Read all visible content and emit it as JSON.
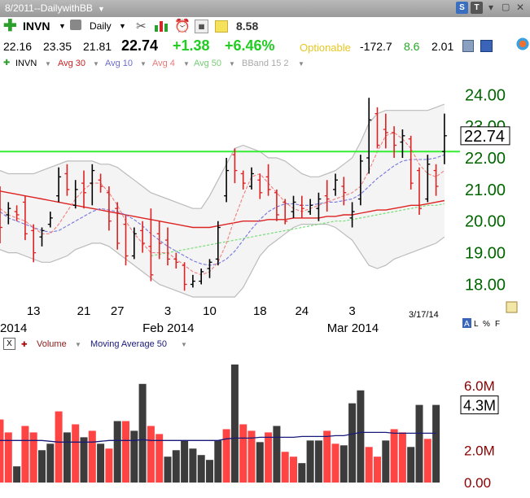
{
  "window": {
    "title": "8/2011--DailywithBB"
  },
  "toolbar": {
    "symbol": "INVN",
    "interval": "Daily",
    "price_box": "8.58"
  },
  "quote": {
    "open": "22.16",
    "high": "23.35",
    "low": "21.81",
    "last": "22.74",
    "change": "+1.38",
    "change_pct": "+6.46%",
    "optionable": "Optionable",
    "v1": "-172.7",
    "v2": "8.6",
    "v3": "2.01"
  },
  "legend": {
    "symbol": "INVN",
    "avg30": "Avg 30",
    "avg10": "Avg 10",
    "avg4": "Avg 4",
    "avg50": "Avg 50",
    "bband": "BBand 15 2",
    "volume": "Volume",
    "ma50": "Moving Average 50",
    "close_label": "X"
  },
  "colors": {
    "up": "#000000",
    "down": "#dd2222",
    "avg30": "#dd2222",
    "avg10": "#7777dd",
    "avg4": "#f08080",
    "avg50": "#77dd77",
    "hline": "#33ee33",
    "vol_up": "#3c3c3c",
    "vol_down": "#ff4444",
    "vol_ma": "#1a1a7a",
    "price_axis": "#006600",
    "vol_axis": "#8b0000",
    "band_fill": "#f4f4f4",
    "band_line": "#bbbbbb"
  },
  "chart_data": [
    {
      "type": "ohlc",
      "ylim": [
        17.6,
        24.6
      ],
      "yticks": [
        18,
        19,
        20,
        21,
        22,
        23,
        24
      ],
      "ytick_labels": [
        "18.00",
        "19.00",
        "20.00",
        "21.00",
        "22.00",
        "23.00",
        "24.00"
      ],
      "last_value_label": "22.74",
      "horizontal_line": 22.2,
      "date_labels": [
        "13",
        "21",
        "27",
        "3",
        "10",
        "18",
        "24",
        "3"
      ],
      "date_label_bars": [
        4,
        10,
        14,
        20,
        25,
        31,
        36,
        42
      ],
      "month_labels": [
        "2014",
        "Feb 2014",
        "Mar 2014"
      ],
      "month_label_bars": [
        0,
        17,
        39
      ],
      "footer_date": "3/17/14",
      "bars": [
        {
          "o": 20.8,
          "h": 21.1,
          "l": 19.3,
          "c": 19.8
        },
        {
          "o": 20.2,
          "h": 20.6,
          "l": 19.9,
          "c": 20.4
        },
        {
          "o": 20.3,
          "h": 20.5,
          "l": 20.0,
          "c": 20.2
        },
        {
          "o": 20.6,
          "h": 20.8,
          "l": 19.4,
          "c": 19.6
        },
        {
          "o": 19.7,
          "h": 19.9,
          "l": 18.7,
          "c": 19.0
        },
        {
          "o": 19.5,
          "h": 19.8,
          "l": 19.2,
          "c": 19.7
        },
        {
          "o": 19.9,
          "h": 20.3,
          "l": 19.8,
          "c": 20.1
        },
        {
          "o": 20.8,
          "h": 21.7,
          "l": 20.6,
          "c": 21.4
        },
        {
          "o": 21.5,
          "h": 21.8,
          "l": 20.8,
          "c": 21.0
        },
        {
          "o": 20.5,
          "h": 21.3,
          "l": 20.4,
          "c": 21.0
        },
        {
          "o": 21.2,
          "h": 21.6,
          "l": 20.4,
          "c": 20.9
        },
        {
          "o": 21.2,
          "h": 21.8,
          "l": 20.5,
          "c": 21.6
        },
        {
          "o": 21.3,
          "h": 21.5,
          "l": 20.9,
          "c": 21.1
        },
        {
          "o": 20.9,
          "h": 21.1,
          "l": 19.7,
          "c": 20.0
        },
        {
          "o": 20.4,
          "h": 20.6,
          "l": 19.1,
          "c": 19.3
        },
        {
          "o": 19.9,
          "h": 20.2,
          "l": 18.6,
          "c": 18.9
        },
        {
          "o": 18.9,
          "h": 19.8,
          "l": 18.8,
          "c": 19.6
        },
        {
          "o": 19.7,
          "h": 20.0,
          "l": 19.0,
          "c": 19.3
        },
        {
          "o": 19.2,
          "h": 20.4,
          "l": 18.1,
          "c": 18.3
        },
        {
          "o": 19.6,
          "h": 20.0,
          "l": 18.8,
          "c": 19.3
        },
        {
          "o": 19.4,
          "h": 19.8,
          "l": 18.6,
          "c": 18.8
        },
        {
          "o": 18.8,
          "h": 19.0,
          "l": 18.5,
          "c": 18.7
        },
        {
          "o": 18.6,
          "h": 18.7,
          "l": 17.8,
          "c": 18.0
        },
        {
          "o": 18.0,
          "h": 18.3,
          "l": 17.9,
          "c": 18.1
        },
        {
          "o": 18.1,
          "h": 18.5,
          "l": 18.0,
          "c": 18.4
        },
        {
          "o": 18.5,
          "h": 18.8,
          "l": 18.2,
          "c": 18.7
        },
        {
          "o": 18.8,
          "h": 20.0,
          "l": 18.6,
          "c": 19.8
        },
        {
          "o": 20.8,
          "h": 22.0,
          "l": 20.6,
          "c": 21.6
        },
        {
          "o": 22.1,
          "h": 22.3,
          "l": 21.2,
          "c": 21.6
        },
        {
          "o": 21.5,
          "h": 21.6,
          "l": 21.0,
          "c": 21.2
        },
        {
          "o": 21.1,
          "h": 21.7,
          "l": 21.0,
          "c": 21.5
        },
        {
          "o": 21.3,
          "h": 21.5,
          "l": 20.7,
          "c": 20.9
        },
        {
          "o": 21.4,
          "h": 21.8,
          "l": 20.8,
          "c": 21.0
        },
        {
          "o": 20.9,
          "h": 21.0,
          "l": 20.0,
          "c": 20.2
        },
        {
          "o": 20.6,
          "h": 20.7,
          "l": 19.9,
          "c": 20.0
        },
        {
          "o": 20.3,
          "h": 20.8,
          "l": 20.1,
          "c": 20.6
        },
        {
          "o": 20.5,
          "h": 20.8,
          "l": 20.1,
          "c": 20.4
        },
        {
          "o": 20.3,
          "h": 20.7,
          "l": 20.2,
          "c": 20.5
        },
        {
          "o": 20.4,
          "h": 20.9,
          "l": 20.0,
          "c": 20.7
        },
        {
          "o": 20.8,
          "h": 21.3,
          "l": 20.3,
          "c": 20.7
        },
        {
          "o": 21.0,
          "h": 21.5,
          "l": 20.8,
          "c": 21.3
        },
        {
          "o": 21.1,
          "h": 21.4,
          "l": 20.5,
          "c": 20.9
        },
        {
          "o": 20.1,
          "h": 20.6,
          "l": 19.8,
          "c": 20.3
        },
        {
          "o": 20.7,
          "h": 22.1,
          "l": 20.5,
          "c": 21.9
        },
        {
          "o": 22.0,
          "h": 23.9,
          "l": 21.5,
          "c": 23.2
        },
        {
          "o": 23.4,
          "h": 23.6,
          "l": 22.3,
          "c": 22.4
        },
        {
          "o": 22.9,
          "h": 23.4,
          "l": 22.3,
          "c": 22.8
        },
        {
          "o": 22.8,
          "h": 23.0,
          "l": 22.0,
          "c": 22.4
        },
        {
          "o": 22.5,
          "h": 22.9,
          "l": 22.0,
          "c": 22.7
        },
        {
          "o": 22.6,
          "h": 22.7,
          "l": 21.0,
          "c": 21.2
        },
        {
          "o": 21.6,
          "h": 21.7,
          "l": 20.2,
          "c": 20.4
        },
        {
          "o": 20.7,
          "h": 22.1,
          "l": 20.6,
          "c": 21.8
        },
        {
          "o": 21.6,
          "h": 21.8,
          "l": 20.8,
          "c": 21.1
        },
        {
          "o": 22.2,
          "h": 23.4,
          "l": 21.8,
          "c": 22.7
        }
      ],
      "avg30": [
        20.95,
        20.9,
        20.85,
        20.8,
        20.75,
        20.7,
        20.65,
        20.6,
        20.55,
        20.5,
        20.45,
        20.4,
        20.35,
        20.3,
        20.25,
        20.2,
        20.15,
        20.1,
        20.05,
        20.0,
        19.95,
        19.9,
        19.85,
        19.8,
        19.8,
        19.8,
        19.85,
        19.9,
        19.95,
        20.0,
        20.0,
        20.0,
        20.05,
        20.05,
        20.05,
        20.1,
        20.1,
        20.1,
        20.1,
        20.15,
        20.15,
        20.2,
        20.2,
        20.25,
        20.3,
        20.35,
        20.35,
        20.4,
        20.45,
        20.5,
        20.5,
        20.55,
        20.6,
        20.65
      ],
      "avg10": [
        20.3,
        20.1,
        20.0,
        19.9,
        19.8,
        19.7,
        19.65,
        19.7,
        19.85,
        20.0,
        20.15,
        20.3,
        20.4,
        20.35,
        20.3,
        20.2,
        20.05,
        19.85,
        19.6,
        19.4,
        19.2,
        19.05,
        18.9,
        18.75,
        18.65,
        18.6,
        18.65,
        18.8,
        19.05,
        19.4,
        19.75,
        20.05,
        20.3,
        20.45,
        20.55,
        20.55,
        20.5,
        20.5,
        20.55,
        20.6,
        20.6,
        20.65,
        20.7,
        20.85,
        21.1,
        21.35,
        21.55,
        21.75,
        21.9,
        21.95,
        21.95,
        21.95,
        22.0,
        22.1
      ],
      "avg4": [
        20.4,
        20.2,
        20.1,
        20.0,
        19.8,
        19.6,
        19.6,
        19.9,
        20.3,
        20.7,
        21.0,
        21.2,
        21.2,
        20.9,
        20.5,
        20.0,
        19.6,
        19.3,
        19.0,
        19.0,
        19.0,
        18.8,
        18.6,
        18.4,
        18.3,
        18.4,
        18.7,
        19.3,
        20.1,
        20.8,
        21.4,
        21.5,
        21.2,
        20.9,
        20.6,
        20.4,
        20.3,
        20.4,
        20.5,
        20.6,
        20.7,
        20.8,
        20.9,
        21.1,
        21.6,
        22.2,
        22.7,
        22.8,
        22.6,
        22.3,
        21.8,
        21.5,
        21.4,
        21.6
      ],
      "avg50": [
        null,
        null,
        null,
        null,
        null,
        null,
        null,
        null,
        null,
        null,
        null,
        null,
        null,
        null,
        null,
        null,
        null,
        null,
        18.9,
        18.95,
        19.0,
        19.05,
        19.1,
        19.15,
        19.2,
        19.25,
        19.3,
        19.35,
        19.4,
        19.45,
        19.5,
        19.55,
        19.6,
        19.65,
        19.7,
        19.75,
        19.8,
        19.85,
        19.9,
        19.95,
        20.0,
        20.0,
        20.05,
        20.1,
        20.15,
        20.2,
        20.25,
        20.3,
        20.35,
        20.4,
        20.45,
        20.5,
        20.5,
        20.55
      ],
      "bb_upper": [
        21.6,
        21.5,
        21.5,
        21.5,
        21.5,
        21.6,
        21.7,
        21.8,
        21.9,
        21.9,
        21.9,
        21.9,
        21.8,
        21.8,
        21.7,
        21.5,
        21.3,
        21.1,
        20.9,
        20.8,
        20.7,
        20.6,
        20.5,
        20.4,
        20.4,
        20.8,
        21.3,
        21.8,
        22.3,
        22.4,
        22.3,
        22.2,
        22.0,
        22.0,
        21.9,
        21.7,
        21.5,
        21.4,
        21.4,
        21.5,
        21.6,
        21.8,
        22.0,
        22.5,
        23.1,
        23.4,
        23.5,
        23.5,
        23.5,
        23.5,
        23.5,
        23.5,
        23.6,
        23.7
      ],
      "bb_lower": [
        19.1,
        19.0,
        19.0,
        18.9,
        18.8,
        18.7,
        18.7,
        18.8,
        18.9,
        19.1,
        19.2,
        19.3,
        19.3,
        19.2,
        19.0,
        18.8,
        18.6,
        18.4,
        18.2,
        18.0,
        17.9,
        17.8,
        17.7,
        17.6,
        17.6,
        17.6,
        17.6,
        17.6,
        17.6,
        17.9,
        18.4,
        18.9,
        19.2,
        19.4,
        19.6,
        19.8,
        19.9,
        19.9,
        19.9,
        19.9,
        19.8,
        19.6,
        19.4,
        19.0,
        18.6,
        18.5,
        18.6,
        18.8,
        18.9,
        19.0,
        19.1,
        19.2,
        19.3,
        19.5
      ]
    },
    {
      "type": "bar",
      "title": "Volume",
      "ylim": [
        0,
        7.8
      ],
      "yticks": [
        0,
        2,
        4,
        6
      ],
      "ytick_labels": [
        "0.00",
        "2.0M",
        "",
        "6.0M"
      ],
      "last_value_label": "4.3M",
      "values": [
        3.9,
        3.1,
        1.0,
        3.5,
        3.1,
        2.0,
        2.4,
        4.4,
        3.1,
        3.6,
        2.8,
        3.2,
        2.4,
        2.1,
        3.8,
        3.8,
        3.2,
        6.1,
        3.5,
        3.0,
        1.6,
        2.0,
        2.6,
        2.1,
        1.7,
        1.4,
        2.6,
        3.3,
        7.3,
        3.6,
        3.2,
        2.5,
        3.1,
        3.5,
        1.9,
        1.6,
        1.2,
        2.6,
        2.6,
        3.2,
        2.4,
        2.3,
        4.9,
        5.7,
        2.2,
        1.6,
        2.6,
        3.3,
        3.1,
        2.2,
        4.8,
        2.7,
        4.8
      ],
      "up": [
        false,
        false,
        true,
        false,
        false,
        true,
        true,
        false,
        true,
        false,
        true,
        false,
        true,
        false,
        true,
        false,
        true,
        true,
        false,
        false,
        true,
        true,
        true,
        true,
        true,
        true,
        true,
        false,
        true,
        false,
        false,
        true,
        false,
        true,
        false,
        false,
        true,
        true,
        true,
        false,
        false,
        true,
        true,
        true,
        false,
        false,
        true,
        false,
        false,
        true,
        true,
        false,
        true
      ],
      "ma50": [
        2.6,
        2.6,
        2.6,
        2.6,
        2.6,
        2.6,
        2.55,
        2.5,
        2.5,
        2.5,
        2.5,
        2.5,
        2.55,
        2.6,
        2.6,
        2.6,
        2.6,
        2.65,
        2.6,
        2.6,
        2.6,
        2.6,
        2.6,
        2.6,
        2.6,
        2.6,
        2.6,
        2.7,
        2.75,
        2.75,
        2.75,
        2.8,
        2.8,
        2.8,
        2.8,
        2.8,
        2.85,
        2.85,
        2.85,
        2.85,
        2.9,
        2.9,
        3.0,
        3.1,
        3.1,
        3.1,
        3.1,
        3.05,
        3.05,
        3.05,
        3.05,
        3.05,
        3.05
      ]
    }
  ]
}
